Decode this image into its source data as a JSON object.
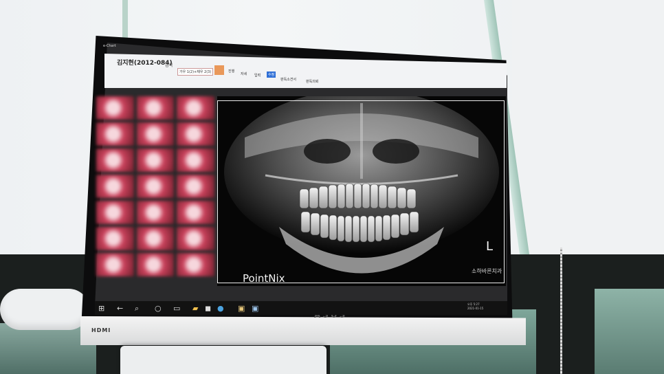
{
  "window": {
    "title_prefix": "e-Chart"
  },
  "ribbon": {
    "patient_name": "김지현(2012-084)",
    "search_label": "검색",
    "search_field": "가우 1(2)+채우 2(3)",
    "tool_labels": [
      "진행",
      "자세",
      "입력",
      "수정",
      "판독소견서",
      "판독의뢰"
    ],
    "highlight_color": "#e9985a"
  },
  "viewer": {
    "watermark": "PointNix",
    "side_marker": "L",
    "clinic_label": "소하바른치과"
  },
  "monitor": {
    "brand": "ASUS",
    "port_label": "HDMI"
  },
  "taskbar": {
    "icons": [
      "windows-icon",
      "back-icon",
      "search-icon",
      "cortana-icon",
      "taskview-icon",
      "folder-icon",
      "store-icon",
      "edge-icon",
      "app-icon",
      "app-icon-2"
    ],
    "clock": "오후 5:27",
    "date": "2021-01-15"
  }
}
